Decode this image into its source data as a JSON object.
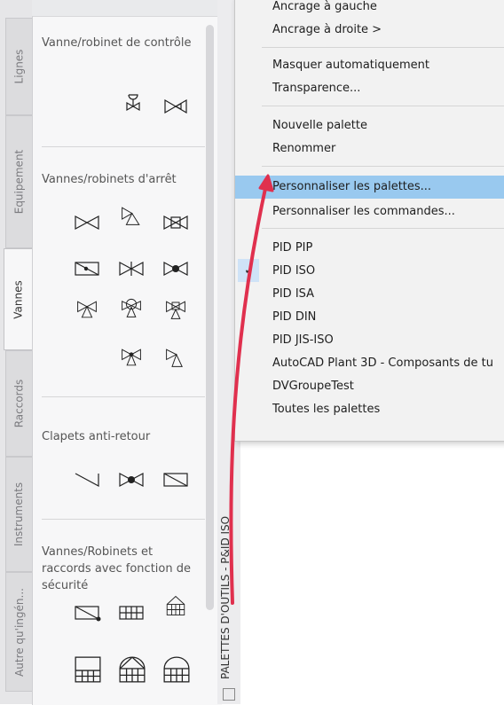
{
  "tabs": [
    {
      "label": "Lignes",
      "active": false
    },
    {
      "label": "Equipement",
      "active": false
    },
    {
      "label": "Vannes",
      "active": true
    },
    {
      "label": "Raccords",
      "active": false
    },
    {
      "label": "Instruments",
      "active": false
    },
    {
      "label": "Autre qu'ingén...",
      "active": false
    }
  ],
  "palette": {
    "sections": [
      {
        "title": "Vanne/robinet de contrôle",
        "icons": [
          "control-valve-icon",
          "control-valve-alt-icon"
        ]
      },
      {
        "title": "Vannes/robinets d'arrêt",
        "icons": [
          "gate-valve-icon",
          "angle-valve-icon",
          "plug-valve-icon",
          "sliding-gate-valve-icon",
          "needle-valve-icon",
          "globe-valve-icon",
          "three-way-valve-icon",
          "diaphragm-valve-icon",
          "pinch-valve-icon",
          "relief-valve-icon",
          "angle-relief-valve-icon"
        ]
      },
      {
        "title": "Clapets anti-retour",
        "icons": [
          "check-valve-icon",
          "ball-check-valve-icon",
          "swing-check-valve-icon"
        ]
      },
      {
        "title": "Vannes/Robinets et raccords avec fonction de sécurité",
        "icons": [
          "safety-valve-icon",
          "rupture-disc-icon",
          "flame-arrester-icon",
          "breather-valve-icon",
          "vent-valve-icon",
          "pressure-vacuum-icon"
        ]
      }
    ]
  },
  "palette_title": "PALETTES D'OUTILS - P&ID ISO",
  "menu": {
    "partial_top": "Ancrage à gauche",
    "items": [
      {
        "label": "Ancrage à droite  >"
      },
      {
        "label": "Masquer automatiquement"
      },
      {
        "label": "Transparence..."
      },
      {
        "label": "Nouvelle palette"
      },
      {
        "label": "Renommer"
      },
      {
        "label": "Personnaliser les palettes...",
        "highlighted": true
      },
      {
        "label": "Personnaliser les commandes..."
      },
      {
        "label": "PID PIP"
      },
      {
        "label": "PID ISO",
        "checked": true
      },
      {
        "label": "PID ISA"
      },
      {
        "label": "PID DIN"
      },
      {
        "label": "PID JIS-ISO"
      },
      {
        "label": "AutoCAD Plant 3D - Composants de tu"
      },
      {
        "label": "DVGroupeTest"
      },
      {
        "label": "Toutes les palettes"
      }
    ]
  },
  "colors": {
    "highlight": "#99c9ef",
    "arrow": "#e0304e"
  }
}
